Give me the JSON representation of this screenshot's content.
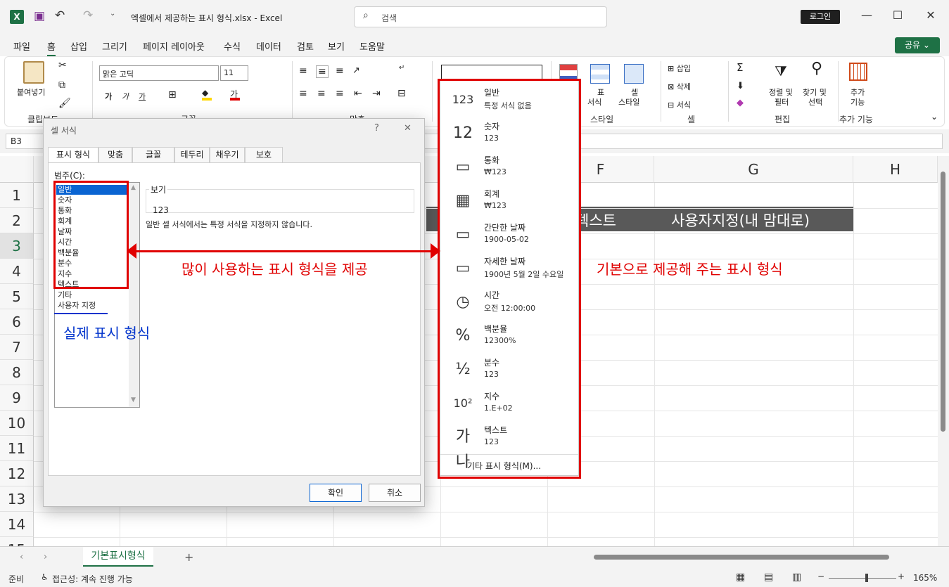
{
  "window": {
    "title": "엑셀에서 제공하는 표시 형식.xlsx  -  Excel",
    "search_placeholder": "검색",
    "login": "로그인"
  },
  "menu": [
    "파일",
    "홈",
    "삽입",
    "그리기",
    "페이지 레이아웃",
    "수식",
    "데이터",
    "검토",
    "보기",
    "도움말"
  ],
  "share": "공유",
  "ribbon": {
    "paste": "붙여넣기",
    "clipboard": "클립보드",
    "font_name": "맑은 고딕",
    "font_size": "11",
    "font_group": "글꼴",
    "align_group": "맞춤",
    "table_format_1": "표",
    "table_format_2": "서식",
    "cell_style_1": "셀",
    "cell_style_2": "스타일",
    "style_group": "스타일",
    "insert": "삽입",
    "delete": "삭제",
    "format": "서식",
    "cells_group": "셀",
    "sort_1": "정렬 및",
    "sort_2": "필터",
    "find_1": "찾기 및",
    "find_2": "선택",
    "edit_group": "편집",
    "addin_1": "추가",
    "addin_2": "기능",
    "addin_group": "추가 기능"
  },
  "formula_bar": {
    "name_box": "B3"
  },
  "grid": {
    "columns": [
      "F",
      "G",
      "H"
    ],
    "rows": [
      "1",
      "2",
      "3",
      "4",
      "5",
      "6",
      "7",
      "8",
      "9",
      "10",
      "11",
      "12",
      "13",
      "14",
      "15"
    ],
    "row2_text_1": "텍스트",
    "row2_text_2": "사용자지정(내 맘대로)"
  },
  "dialog": {
    "title": "셀 서식",
    "help": "?",
    "close": "✕",
    "tabs": [
      "표시 형식",
      "맞춤",
      "글꼴",
      "테두리",
      "채우기",
      "보호"
    ],
    "category_label": "범주(C):",
    "categories": [
      "일반",
      "숫자",
      "통화",
      "회계",
      "날짜",
      "시간",
      "백분율",
      "분수",
      "지수",
      "텍스트",
      "기타",
      "사용자 지정"
    ],
    "preview_label": "보기",
    "preview_value": "123",
    "description": "일반 셀 서식에서는 특정 서식을 지정하지 않습니다.",
    "ok": "확인",
    "cancel": "취소"
  },
  "dropdown": {
    "items": [
      {
        "icon": "clock-123-icon",
        "glyph": "123",
        "name": "일반",
        "sample": "특정 서식 없음"
      },
      {
        "icon": "number-icon",
        "glyph": "12",
        "name": "숫자",
        "sample": "123"
      },
      {
        "icon": "currency-icon",
        "glyph": "▭",
        "name": "통화",
        "sample": "₩123"
      },
      {
        "icon": "accounting-icon",
        "glyph": "▦",
        "name": "회계",
        "sample": " ₩123"
      },
      {
        "icon": "calendar-icon",
        "glyph": "▭",
        "name": "간단한 날짜",
        "sample": "1900-05-02"
      },
      {
        "icon": "calendar-long-icon",
        "glyph": "▭",
        "name": "자세한 날짜",
        "sample": "1900년 5월 2일 수요일"
      },
      {
        "icon": "clock-icon",
        "glyph": "◷",
        "name": "시간",
        "sample": "오전 12:00:00"
      },
      {
        "icon": "percent-icon",
        "glyph": "%",
        "name": "백분율",
        "sample": "12300%"
      },
      {
        "icon": "fraction-icon",
        "glyph": "½",
        "name": "분수",
        "sample": "123"
      },
      {
        "icon": "scientific-icon",
        "glyph": "10²",
        "name": "지수",
        "sample": "1.E+02"
      },
      {
        "icon": "text-icon",
        "glyph": "가나",
        "name": "텍스트",
        "sample": "123"
      }
    ],
    "more": "기타 표시 형식(M)..."
  },
  "annotations": {
    "center": "많이 사용하는 표시 형식을 제공",
    "right": "기본으로 제공해 주는 표시 형식",
    "left": "실제 표시 형식"
  },
  "sheet_tab": "기본표시형식",
  "status": {
    "ready": "준비",
    "accessibility": "접근성: 계속 진행 가능",
    "zoom": "165%"
  },
  "colors": {
    "excel_green": "#1e7145",
    "annotation_red": "#e00000",
    "annotation_blue": "#0033cc"
  }
}
